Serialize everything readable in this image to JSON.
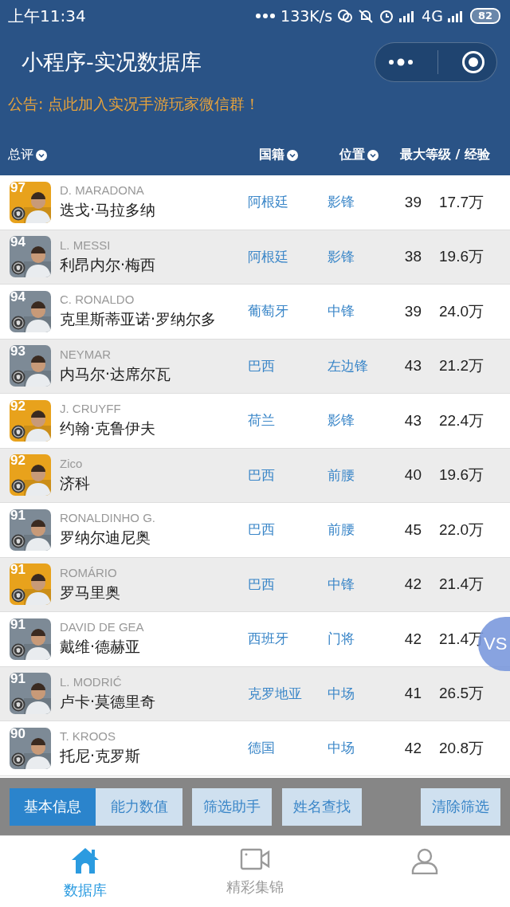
{
  "status_bar": {
    "time": "上午11:34",
    "speed": "133K/s",
    "network": "4G",
    "battery": "82"
  },
  "header": {
    "title": "小程序-实况数据库"
  },
  "notice": "公告: 点此加入实况手游玩家微信群！",
  "columns": [
    "总评",
    "国籍",
    "位置",
    "最大等级 / 经验"
  ],
  "rows": [
    {
      "rating": "97",
      "color": "#e8a21c",
      "en": "D. MARADONA",
      "cn": "迭戈·马拉多纳",
      "nation": "阿根廷",
      "position": "影锋",
      "level": "39",
      "exp": "17.7万"
    },
    {
      "rating": "94",
      "color": "#7d8a96",
      "en": "L. MESSI",
      "cn": "利昂内尔·梅西",
      "nation": "阿根廷",
      "position": "影锋",
      "level": "38",
      "exp": "19.6万"
    },
    {
      "rating": "94",
      "color": "#7d8a96",
      "en": "C. RONALDO",
      "cn": "克里斯蒂亚诺·罗纳尔多",
      "nation": "葡萄牙",
      "position": "中锋",
      "level": "39",
      "exp": "24.0万"
    },
    {
      "rating": "93",
      "color": "#7d8a96",
      "en": "NEYMAR",
      "cn": "内马尔·达席尔瓦",
      "nation": "巴西",
      "position": "左边锋",
      "level": "43",
      "exp": "21.2万"
    },
    {
      "rating": "92",
      "color": "#e8a21c",
      "en": "J. CRUYFF",
      "cn": "约翰·克鲁伊夫",
      "nation": "荷兰",
      "position": "影锋",
      "level": "43",
      "exp": "22.4万"
    },
    {
      "rating": "92",
      "color": "#e8a21c",
      "en": "Zico",
      "cn": "济科",
      "nation": "巴西",
      "position": "前腰",
      "level": "40",
      "exp": "19.6万"
    },
    {
      "rating": "91",
      "color": "#7d8a96",
      "en": "RONALDINHO G.",
      "cn": "罗纳尔迪尼奥",
      "nation": "巴西",
      "position": "前腰",
      "level": "45",
      "exp": "22.0万"
    },
    {
      "rating": "91",
      "color": "#e8a21c",
      "en": "ROMÁRIO",
      "cn": "罗马里奥",
      "nation": "巴西",
      "position": "中锋",
      "level": "42",
      "exp": "21.4万"
    },
    {
      "rating": "91",
      "color": "#7d8a96",
      "en": "DAVID DE GEA",
      "cn": "戴维·德赫亚",
      "nation": "西班牙",
      "position": "门将",
      "level": "42",
      "exp": "21.4万"
    },
    {
      "rating": "91",
      "color": "#7d8a96",
      "en": "L. MODRIĆ",
      "cn": "卢卡·莫德里奇",
      "nation": "克罗地亚",
      "position": "中场",
      "level": "41",
      "exp": "26.5万"
    },
    {
      "rating": "90",
      "color": "#7d8a96",
      "en": "T. KROOS",
      "cn": "托尼·克罗斯",
      "nation": "德国",
      "position": "中场",
      "level": "42",
      "exp": "20.8万"
    }
  ],
  "vs_button": "VS",
  "toolbar": [
    {
      "label": "基本信息",
      "selected": true
    },
    {
      "label": "能力数值",
      "selected": false
    },
    {
      "label": "筛选助手",
      "selected": false
    },
    {
      "label": "姓名查找",
      "selected": false
    },
    {
      "label": "清除筛选",
      "selected": false
    }
  ],
  "tabs": [
    {
      "kind": "home",
      "label": "数据库",
      "selected": true
    },
    {
      "kind": "video",
      "label": "精彩集锦",
      "selected": false
    },
    {
      "kind": "person",
      "selected": false
    }
  ]
}
